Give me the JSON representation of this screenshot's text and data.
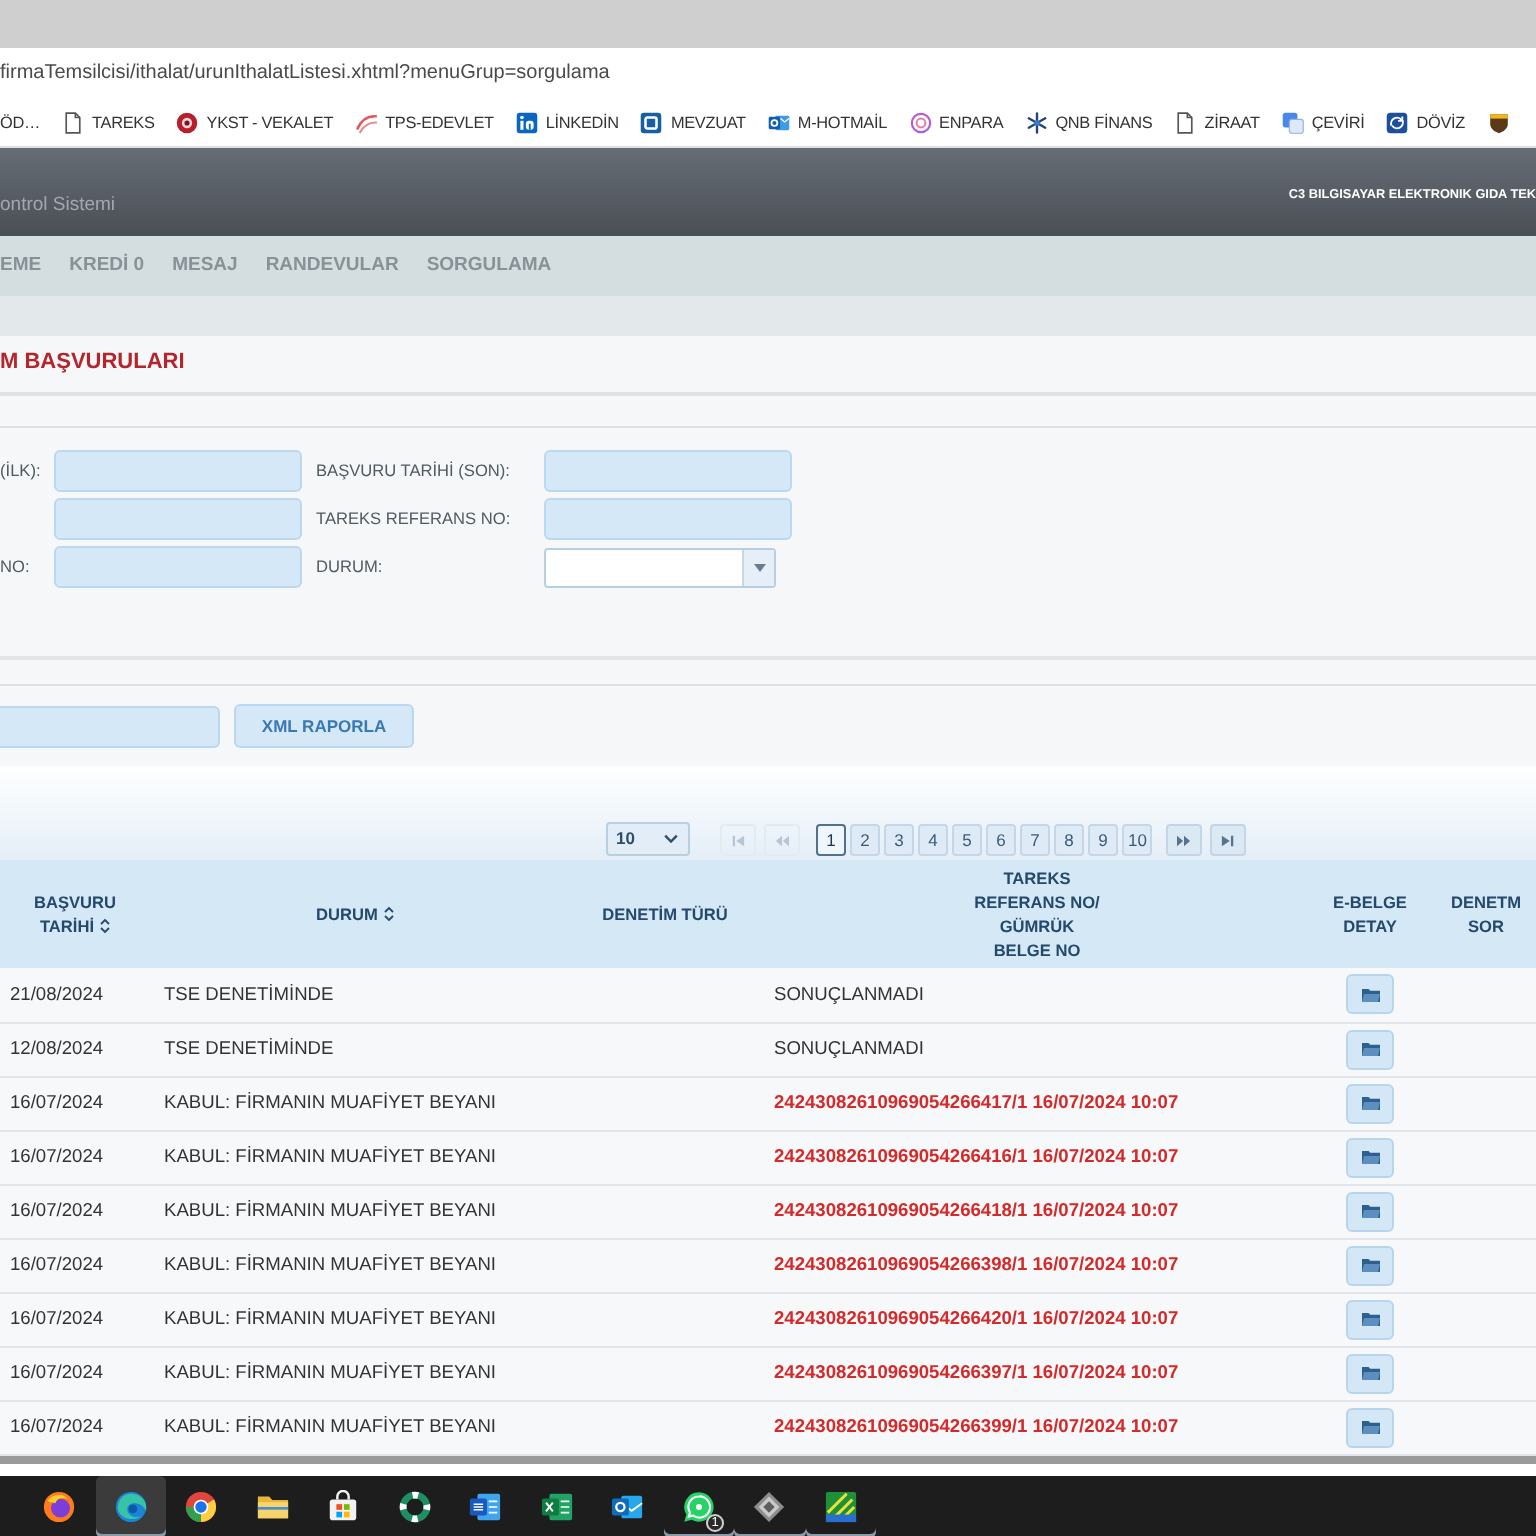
{
  "browser": {
    "url": "firmaTemsilcisi/ithalat/urunIthalatListesi.xhtml?menuGrup=sorgulama",
    "bookmarks": [
      {
        "label": "ÖD…",
        "kind": "plain"
      },
      {
        "label": "TAREKS",
        "kind": "page"
      },
      {
        "label": "YKST - VEKALET",
        "kind": "seal"
      },
      {
        "label": "TPS-EDEVLET",
        "kind": "swoosh"
      },
      {
        "label": "LİNKEDİN",
        "kind": "network"
      },
      {
        "label": "MEVZUAT",
        "kind": "square"
      },
      {
        "label": "M-HOTMAİL",
        "kind": "mail"
      },
      {
        "label": "ENPARA",
        "kind": "ring"
      },
      {
        "label": "QNB FİNANS",
        "kind": "snowflake"
      },
      {
        "label": "ZİRAAT",
        "kind": "page"
      },
      {
        "label": "ÇEVİRİ",
        "kind": "translate"
      },
      {
        "label": "DÖVİZ",
        "kind": "exchange"
      },
      {
        "kind": "shield"
      }
    ]
  },
  "app": {
    "brand": "ontrol Sistemi",
    "company": "C3 BILGISAYAR ELEKTRONIK GIDA TEK",
    "menu": [
      "EME",
      "KREDİ 0",
      "MESAJ",
      "RANDEVULAR",
      "SORGULAMA"
    ]
  },
  "page": {
    "title": "M BAŞVURULARI",
    "filters": [
      [
        {
          "label": "(İLK):",
          "kind": "text"
        },
        {
          "label": "BAŞVURU TARİHİ (SON):",
          "kind": "text"
        }
      ],
      [
        {
          "kind": "text"
        },
        {
          "label": "TAREKS REFERANS NO:",
          "kind": "text"
        }
      ],
      [
        {
          "label": "NO:",
          "kind": "text"
        },
        {
          "label": "DURUM:",
          "kind": "select"
        }
      ]
    ],
    "actions": [
      {
        "kind": "field"
      },
      {
        "kind": "button",
        "label": "XML RAPORLA"
      }
    ]
  },
  "table": {
    "page_size": "10",
    "pager": [
      {
        "kind": "first",
        "disabled": true
      },
      {
        "kind": "prev",
        "disabled": true
      },
      {
        "kind": "page",
        "label": "1",
        "selected": true
      },
      {
        "kind": "page",
        "label": "2",
        "selected": false
      },
      {
        "kind": "page",
        "label": "3",
        "selected": false
      },
      {
        "kind": "page",
        "label": "4",
        "selected": false
      },
      {
        "kind": "page",
        "label": "5",
        "selected": false
      },
      {
        "kind": "page",
        "label": "6",
        "selected": false
      },
      {
        "kind": "page",
        "label": "7",
        "selected": false
      },
      {
        "kind": "page",
        "label": "8",
        "selected": false
      },
      {
        "kind": "page",
        "label": "9",
        "selected": false
      },
      {
        "kind": "page",
        "label": "10",
        "selected": false
      },
      {
        "kind": "next",
        "disabled": false
      },
      {
        "kind": "last",
        "disabled": false
      }
    ],
    "columns": [
      {
        "label": "BAŞVURU\nTARİHİ",
        "sortable": true
      },
      {
        "label": "DURUM",
        "sortable": true
      },
      {
        "label": "DENETİM TÜRÜ",
        "sortable": false
      },
      {
        "label": "TAREKS\nREFERANS NO/\nGÜMRÜK\nBELGE NO",
        "sortable": false
      },
      {
        "label": "E-BELGE\nDETAY",
        "sortable": false
      },
      {
        "label": "DENETM\nSOR",
        "sortable": false
      }
    ],
    "rows": [
      {
        "date": "21/08/2024",
        "status": "TSE DENETİMİNDE",
        "reference": "SONUÇLANMADI",
        "flagged": false
      },
      {
        "date": "12/08/2024",
        "status": "TSE DENETİMİNDE",
        "reference": "SONUÇLANMADI",
        "flagged": false
      },
      {
        "date": "16/07/2024",
        "status": "KABUL: FİRMANIN MUAFİYET BEYANI",
        "reference": "24243082610969054266417/1 16/07/2024 10:07",
        "flagged": true
      },
      {
        "date": "16/07/2024",
        "status": "KABUL: FİRMANIN MUAFİYET BEYANI",
        "reference": "24243082610969054266416/1 16/07/2024 10:07",
        "flagged": true
      },
      {
        "date": "16/07/2024",
        "status": "KABUL: FİRMANIN MUAFİYET BEYANI",
        "reference": "24243082610969054266418/1 16/07/2024 10:07",
        "flagged": true
      },
      {
        "date": "16/07/2024",
        "status": "KABUL: FİRMANIN MUAFİYET BEYANI",
        "reference": "24243082610969054266398/1 16/07/2024 10:07",
        "flagged": true
      },
      {
        "date": "16/07/2024",
        "status": "KABUL: FİRMANIN MUAFİYET BEYANI",
        "reference": "24243082610969054266420/1 16/07/2024 10:07",
        "flagged": true
      },
      {
        "date": "16/07/2024",
        "status": "KABUL: FİRMANIN MUAFİYET BEYANI",
        "reference": "24243082610969054266397/1 16/07/2024 10:07",
        "flagged": true
      },
      {
        "date": "16/07/2024",
        "status": "KABUL: FİRMANIN MUAFİYET BEYANI",
        "reference": "24243082610969054266399/1 16/07/2024 10:07",
        "flagged": true
      }
    ]
  },
  "taskbar": [
    {
      "kind": "firefox",
      "selected": false,
      "running": false
    },
    {
      "kind": "edge",
      "selected": true,
      "running": true
    },
    {
      "kind": "chrome",
      "selected": false,
      "running": false
    },
    {
      "kind": "folder",
      "selected": false,
      "running": false
    },
    {
      "kind": "store",
      "selected": false,
      "running": false
    },
    {
      "kind": "lifebuoy",
      "selected": false,
      "running": false
    },
    {
      "kind": "word",
      "selected": false,
      "running": false
    },
    {
      "kind": "excel",
      "selected": false,
      "running": false
    },
    {
      "kind": "outlook",
      "selected": false,
      "running": false
    },
    {
      "kind": "whatsapp",
      "selected": false,
      "running": true,
      "badge": "1"
    },
    {
      "kind": "diamond",
      "selected": false,
      "running": true
    },
    {
      "kind": "stripes",
      "selected": false,
      "running": true
    }
  ]
}
